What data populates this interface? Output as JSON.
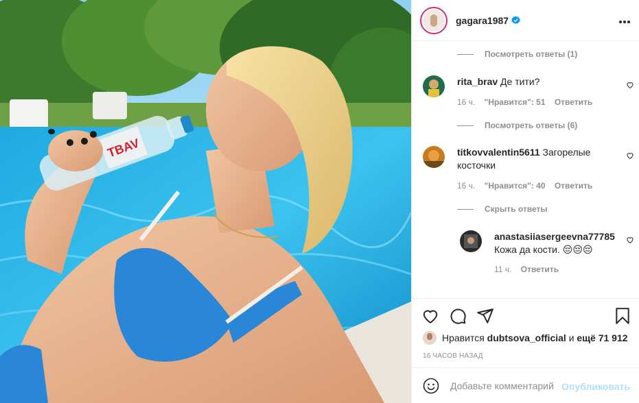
{
  "post": {
    "username": "gagara1987",
    "more_icon": "more-horizontal-icon",
    "verified_icon": "verified-badge-icon",
    "photo_text": "TBAV"
  },
  "comments": {
    "view_replies_top": "Посмотреть ответы (1)",
    "items": [
      {
        "username": "rita_brav",
        "text": "Де тити?",
        "time": "16 ч.",
        "likes": "\"Нравится\": 51",
        "reply": "Ответить",
        "view_replies": "Посмотреть ответы (6)"
      },
      {
        "username": "titkovvalentin5611",
        "text": "Загорелые косточки",
        "time": "16 ч.",
        "likes": "\"Нравится\": 40",
        "reply": "Ответить",
        "hide_replies": "Скрыть ответы"
      }
    ],
    "replies": [
      {
        "username": "anastasiiasergeevna77785",
        "text": "Кожа да кости. 😔😔😔",
        "time": "11 ч.",
        "reply": "Ответить"
      }
    ]
  },
  "actions": {
    "icons": [
      "heart-icon",
      "comment-icon",
      "share-icon",
      "bookmark-icon"
    ],
    "likes_prefix": "Нравится",
    "likes_user": "dubtsova_official",
    "likes_and": "и",
    "likes_rest": "ещё 71 912",
    "timestamp": "16 ЧАСОВ НАЗАД"
  },
  "add_comment": {
    "placeholder": "Добавьте комментарий...",
    "publish": "Опубликовать",
    "emoji_icon": "smiley-icon"
  },
  "colors": {
    "link_blue": "#0095f6",
    "publish_disabled": "#b2dffc",
    "muted": "#8e8e8e",
    "text": "#262626",
    "border": "#efefef"
  }
}
